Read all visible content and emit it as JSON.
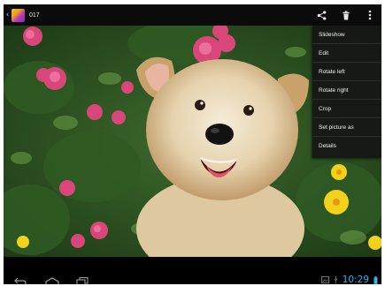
{
  "action_bar": {
    "up_icon": "chevron-left-icon",
    "app_icon": "gallery-icon",
    "album_title": "017",
    "share_icon": "share-icon",
    "delete_icon": "trash-icon",
    "overflow_icon": "more-vert-icon"
  },
  "overflow_menu": {
    "items": [
      {
        "label": "Slideshow"
      },
      {
        "label": "Edit"
      },
      {
        "label": "Rotate left"
      },
      {
        "label": "Rotate right"
      },
      {
        "label": "Crop"
      },
      {
        "label": "Set picture as"
      },
      {
        "label": "Details"
      }
    ]
  },
  "nav_bar": {
    "back_icon": "back-icon",
    "home_icon": "home-icon",
    "recents_icon": "recents-icon",
    "clock": "10:29",
    "accent_color": "#33b5e5"
  }
}
